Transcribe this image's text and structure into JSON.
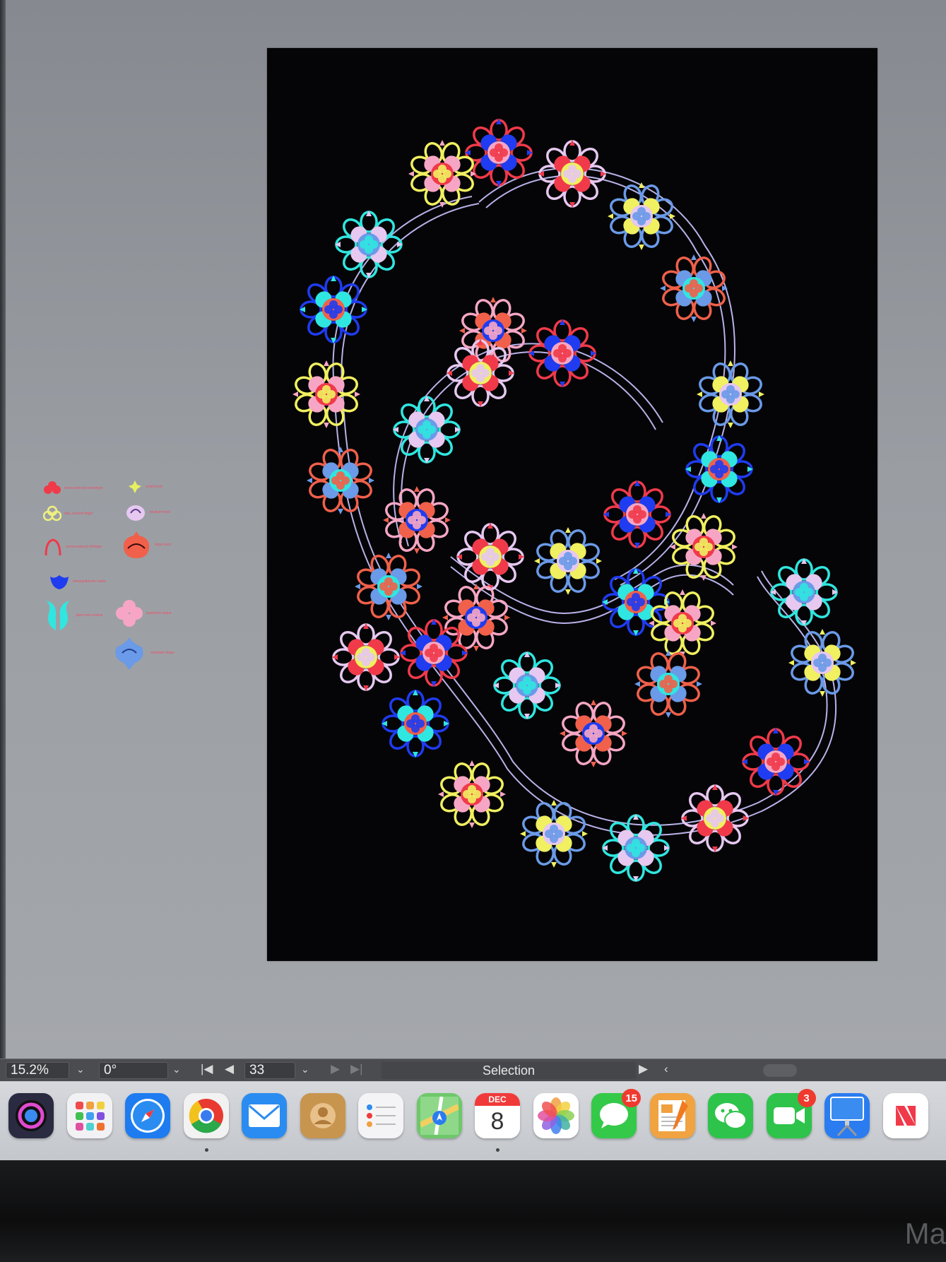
{
  "statusbar": {
    "zoom": "15.2%",
    "rotation": "0°",
    "artboard_number": "33",
    "tool": "Selection"
  },
  "legend": {
    "items": [
      {
        "shape": "flower-icon",
        "color": "#f03a4a",
        "label": "monocarboxyl overhinge"
      },
      {
        "shape": "small-knob-icon",
        "color": "#e8f060",
        "label": "small knob"
      },
      {
        "shape": "trefoil-outline-icon",
        "color": "#f0f080",
        "label": "aba_around finger"
      },
      {
        "shape": "medium-knob-icon",
        "color": "#e6c8f0",
        "label": "medium knob"
      },
      {
        "shape": "arch-outline-icon",
        "color": "#f03a4a",
        "label": "monocarboxyl olifringer"
      },
      {
        "shape": "large-knob-icon",
        "color": "#f0604a",
        "label": "large knob"
      },
      {
        "shape": "lotus-icon",
        "color": "#1f3cf0",
        "label": "stonegutbloom matta"
      },
      {
        "shape": "twin-leaf-icon",
        "color": "#30e6e0",
        "label": "plant root extenal"
      },
      {
        "shape": "quatrefoil-icon",
        "color": "#f6a6c4",
        "label": "quatrefoil shape"
      },
      {
        "shape": "drop-icon",
        "color": "#6a9ae8",
        "label": "standard drape"
      }
    ]
  },
  "dock": {
    "apps": [
      {
        "name": "siri-icon",
        "color": "#2a2a40",
        "badge": ""
      },
      {
        "name": "launchpad-icon",
        "color": "#f2f2f4",
        "badge": ""
      },
      {
        "name": "safari-icon",
        "color": "#1e7cf0",
        "badge": ""
      },
      {
        "name": "chrome-icon",
        "color": "#f2f2f2",
        "badge": ""
      },
      {
        "name": "mail-icon",
        "color": "#2a8cf0",
        "badge": ""
      },
      {
        "name": "contacts-icon",
        "color": "#c8954e",
        "badge": ""
      },
      {
        "name": "reminders-icon",
        "color": "#f4f4f6",
        "badge": ""
      },
      {
        "name": "maps-icon",
        "color": "#6ec86a",
        "badge": ""
      },
      {
        "name": "calendar-icon",
        "color": "#ffffff",
        "badge": "",
        "month": "DEC",
        "day": "8"
      },
      {
        "name": "photos-icon",
        "color": "#ffffff",
        "badge": ""
      },
      {
        "name": "messages-icon",
        "color": "#35c94a",
        "badge": "15"
      },
      {
        "name": "pages-icon",
        "color": "#f0a340",
        "badge": ""
      },
      {
        "name": "wechat-icon",
        "color": "#2ec34a",
        "badge": ""
      },
      {
        "name": "facetime-icon",
        "color": "#2ec34a",
        "badge": "3"
      },
      {
        "name": "keynote-icon",
        "color": "#2a7cf0",
        "badge": ""
      },
      {
        "name": "news-icon",
        "color": "#ffffff",
        "badge": ""
      }
    ]
  },
  "bezel": {
    "text": "Ma"
  },
  "artwork": {
    "palette": [
      "#f03a4a",
      "#6a9ae8",
      "#1f3cf0",
      "#f0f060",
      "#30e6e0",
      "#f6a6c4",
      "#e6c8f0",
      "#f0604a"
    ]
  }
}
